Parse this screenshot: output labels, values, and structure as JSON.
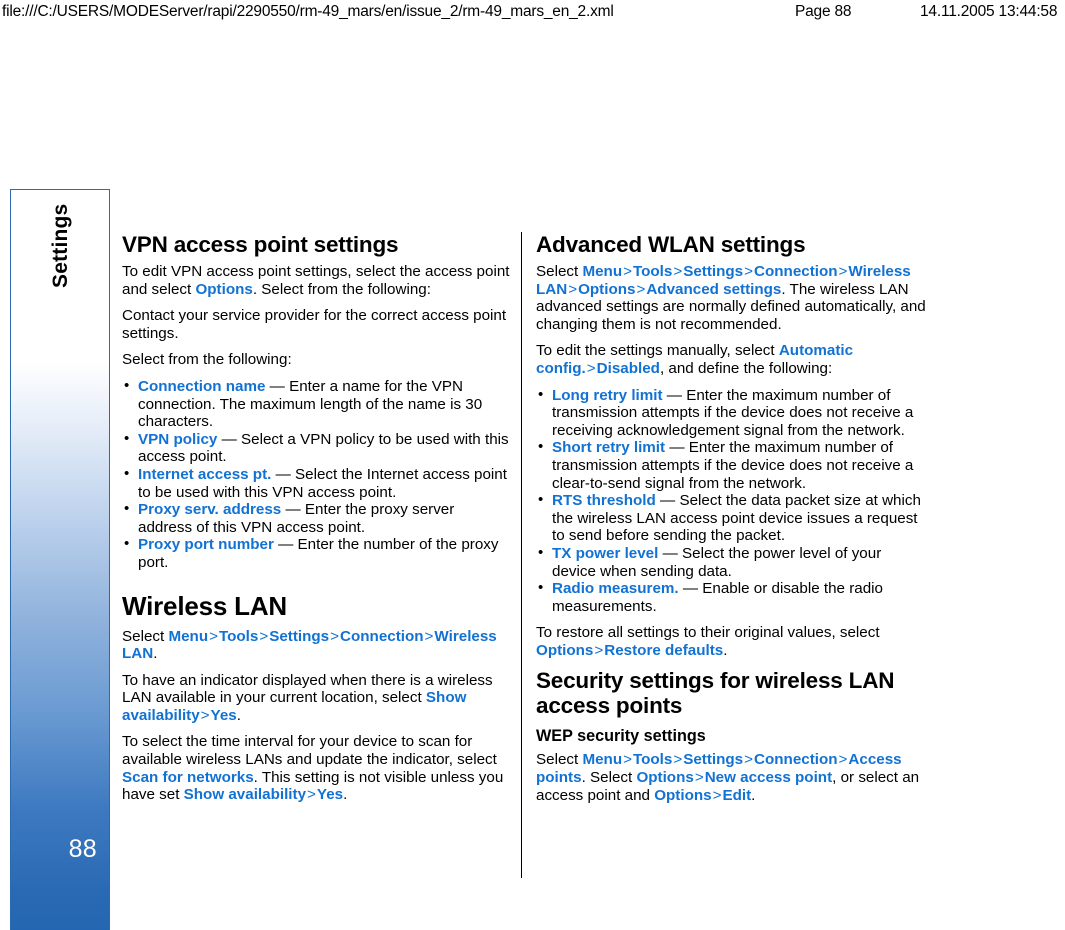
{
  "print_header": {
    "url": "file:///C:/USERS/MODEServer/rapi/2290550/rm-49_mars/en/issue_2/rm-49_mars_en_2.xml",
    "page": "Page 88",
    "datetime": "14.11.2005 13:44:58"
  },
  "side_tab": {
    "label": "Settings",
    "page_number": "88",
    "border_color": "#2a6ab0",
    "gradient_end_color": "#2566b2"
  },
  "colors": {
    "link": "#1272d3",
    "text": "#000000"
  },
  "left_column": {
    "section_1": {
      "title": "VPN access point settings",
      "para_1_a": "To edit VPN access point settings, select the access point and select ",
      "para_1_link": "Options",
      "para_1_b": ". Select from the following:",
      "para_2": "Contact your service provider for the correct access point settings.",
      "para_3": "Select from the following:",
      "bullets": [
        {
          "term": "Connection name",
          "dash": "—",
          "text": "Enter a name for the VPN connection. The maximum length of the name is 30 characters."
        },
        {
          "term": "VPN policy",
          "dash": "—",
          "text": "Select a VPN policy to be used with this access point."
        },
        {
          "term": "Internet access pt.",
          "dash": "—",
          "text": "Select the Internet access point to be used with this VPN access point."
        },
        {
          "term": "Proxy serv. address",
          "dash": "—",
          "text": "Enter the proxy server address of this VPN access point."
        },
        {
          "term": "Proxy port number",
          "dash": "—",
          "text": "Enter the number of the proxy port."
        }
      ]
    },
    "section_2": {
      "title": "Wireless LAN",
      "path_1": {
        "lead": "Select ",
        "items": [
          "Menu",
          "Tools",
          "Settings",
          "Connection",
          "Wireless LAN"
        ],
        "sep": ">",
        "tail": "."
      },
      "para_1_a": "To have an indicator displayed when there is a wireless LAN available in your current location, select ",
      "para_1_link_1": "Show availability",
      "para_1_sep": ">",
      "para_1_link_2": "Yes",
      "para_1_b": ".",
      "para_2_a": "To select the time interval for your device to scan for available wireless LANs and update the indicator, select ",
      "para_2_link_1": "Scan for networks",
      "para_2_b": ". This setting is not visible unless you have set ",
      "para_2_link_2": "Show availability",
      "para_2_sep": ">",
      "para_2_link_3": "Yes",
      "para_2_c": "."
    }
  },
  "right_column": {
    "section_1": {
      "title": "Advanced WLAN settings",
      "path_1": {
        "lead": "Select ",
        "items": [
          "Menu",
          "Tools",
          "Settings",
          "Connection",
          "Wireless LAN",
          "Options",
          "Advanced settings"
        ],
        "sep": ">",
        "tail": ". The wireless LAN advanced settings are normally defined automatically, and changing them is not recommended."
      },
      "para_2_a": "To edit the settings manually, select ",
      "para_2_link_1": "Automatic config.",
      "para_2_sep": ">",
      "para_2_link_2": "Disabled",
      "para_2_b": ", and define the following:",
      "bullets": [
        {
          "term": "Long retry limit",
          "dash": "—",
          "text": "Enter the maximum number of transmission attempts if the device does not receive a receiving acknowledgement signal from the network."
        },
        {
          "term": "Short retry limit",
          "dash": "—",
          "text": "Enter the maximum number of transmission attempts if the device does not receive a clear-to-send signal from the network."
        },
        {
          "term": "RTS threshold",
          "dash": "—",
          "text": "Select the data packet size at which the wireless LAN access point device issues a request to send before sending the packet."
        },
        {
          "term": "TX power level",
          "dash": "—",
          "text": "Select the power level of your device when sending data."
        },
        {
          "term": "Radio measurem.",
          "dash": "—",
          "text": "Enable or disable the radio measurements."
        }
      ],
      "para_3_a": "To restore all settings to their original values, select ",
      "para_3_link_1": "Options",
      "para_3_sep": ">",
      "para_3_link_2": "Restore defaults",
      "para_3_b": "."
    },
    "section_2": {
      "title": "Security settings for wireless LAN access points",
      "subtitle": "WEP security settings",
      "path_1": {
        "lead": "Select ",
        "items": [
          "Menu",
          "Tools",
          "Settings",
          "Connection",
          "Access points"
        ],
        "sep": ">"
      },
      "para_1_a": ". Select ",
      "para_1_link_1": "Options",
      "para_1_sep_1": ">",
      "para_1_link_2": "New access point",
      "para_1_b": ", or select an access point and ",
      "para_1_link_3": "Options",
      "para_1_sep_2": ">",
      "para_1_link_4": "Edit",
      "para_1_c": "."
    }
  }
}
